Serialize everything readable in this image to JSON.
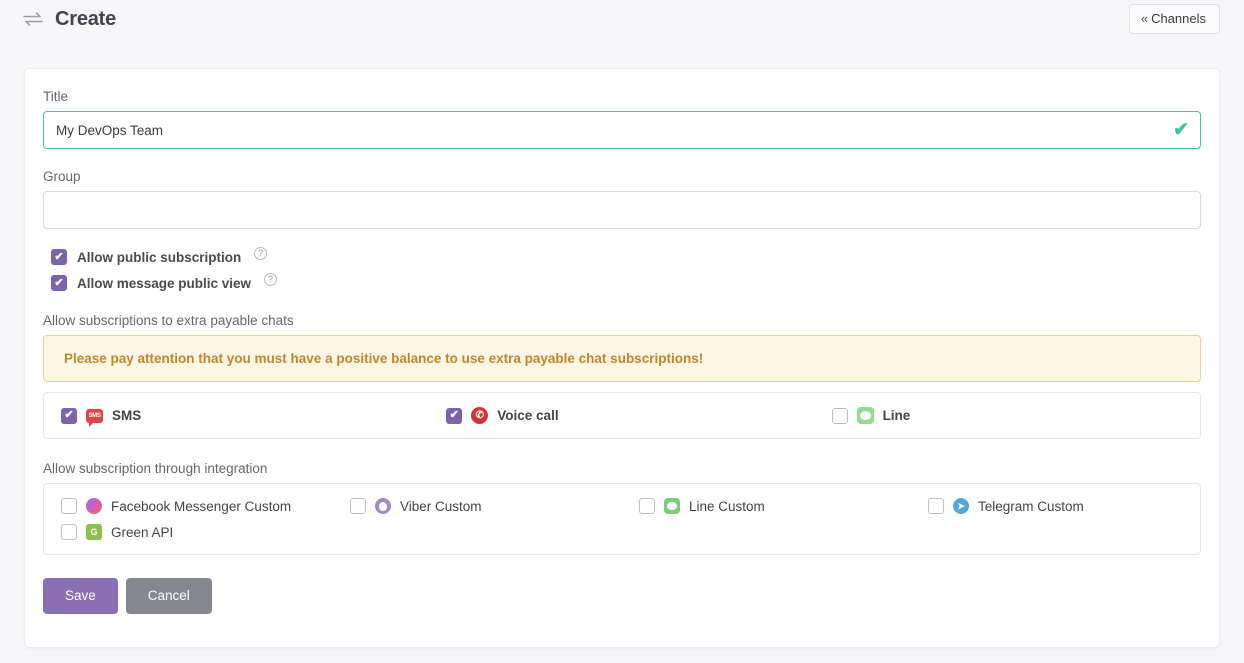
{
  "header": {
    "icon": "exchange-arrows-icon",
    "title": "Create",
    "channels_button": "Channels",
    "channels_chevron": "«"
  },
  "form": {
    "title_label": "Title",
    "title_value": "My DevOps Team",
    "title_placeholder": "",
    "title_valid_mark": "✔",
    "group_label": "Group",
    "group_value": "",
    "group_placeholder": ""
  },
  "toggles": [
    {
      "label": "Allow public subscription",
      "checked": true,
      "help": "?"
    },
    {
      "label": "Allow message public view",
      "checked": true,
      "help": "?"
    }
  ],
  "payable": {
    "section_label": "Allow subscriptions to extra payable chats",
    "alert": "Please pay attention that you must have a positive balance to use extra payable chat subscriptions!",
    "options": [
      {
        "label": "SMS",
        "checked": true,
        "icon": "sms-icon",
        "glyph": "SMS"
      },
      {
        "label": "Voice call",
        "checked": true,
        "icon": "phone-icon",
        "glyph": "✆"
      },
      {
        "label": "Line",
        "checked": false,
        "icon": "line-icon",
        "glyph": ""
      }
    ]
  },
  "integration": {
    "section_label": "Allow subscription through integration",
    "options": [
      {
        "label": "Facebook Messenger Custom",
        "checked": false,
        "icon": "facebook-messenger-icon",
        "glyph": ""
      },
      {
        "label": "Viber Custom",
        "checked": false,
        "icon": "viber-icon",
        "glyph": ""
      },
      {
        "label": "Line Custom",
        "checked": false,
        "icon": "line-icon",
        "glyph": ""
      },
      {
        "label": "Telegram Custom",
        "checked": false,
        "icon": "telegram-icon",
        "glyph": "➤"
      },
      {
        "label": "Green API",
        "checked": false,
        "icon": "green-api-icon",
        "glyph": "G"
      }
    ]
  },
  "actions": {
    "save": "Save",
    "cancel": "Cancel"
  },
  "colors": {
    "accent_purple": "#7e62ac",
    "valid_teal": "#3fc4a7",
    "warning_text": "#c0872a",
    "warning_bg": "#fdf6e7",
    "warning_border": "#f2cf8d",
    "page_bg": "#f7f7fa"
  }
}
